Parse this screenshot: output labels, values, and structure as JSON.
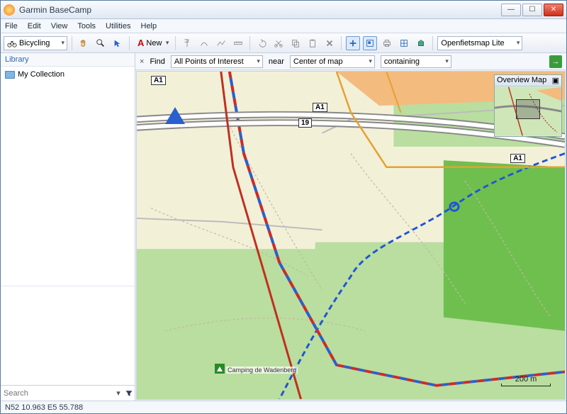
{
  "window": {
    "title": "Garmin BaseCamp"
  },
  "menu": [
    "File",
    "Edit",
    "View",
    "Tools",
    "Utilities",
    "Help"
  ],
  "toolbar": {
    "activity": "Bicycling",
    "new_label": "New",
    "map_product": "Openfietsmap Lite"
  },
  "sidebar": {
    "header": "Library",
    "items": [
      {
        "label": "My Collection"
      }
    ],
    "search_placeholder": "Search"
  },
  "findbar": {
    "find_label": "Find",
    "subject": "All Points of Interest",
    "near_label": "near",
    "location": "Center of map",
    "mode": "containing"
  },
  "overview": {
    "title": "Overview Map"
  },
  "map": {
    "road_badges": [
      "A1",
      "A1",
      "19",
      "A1"
    ],
    "camp_label": "Camping de Wadenberg",
    "scale_label": "200 m"
  },
  "status": {
    "coords": "N52 10.963 E5 55.788"
  }
}
